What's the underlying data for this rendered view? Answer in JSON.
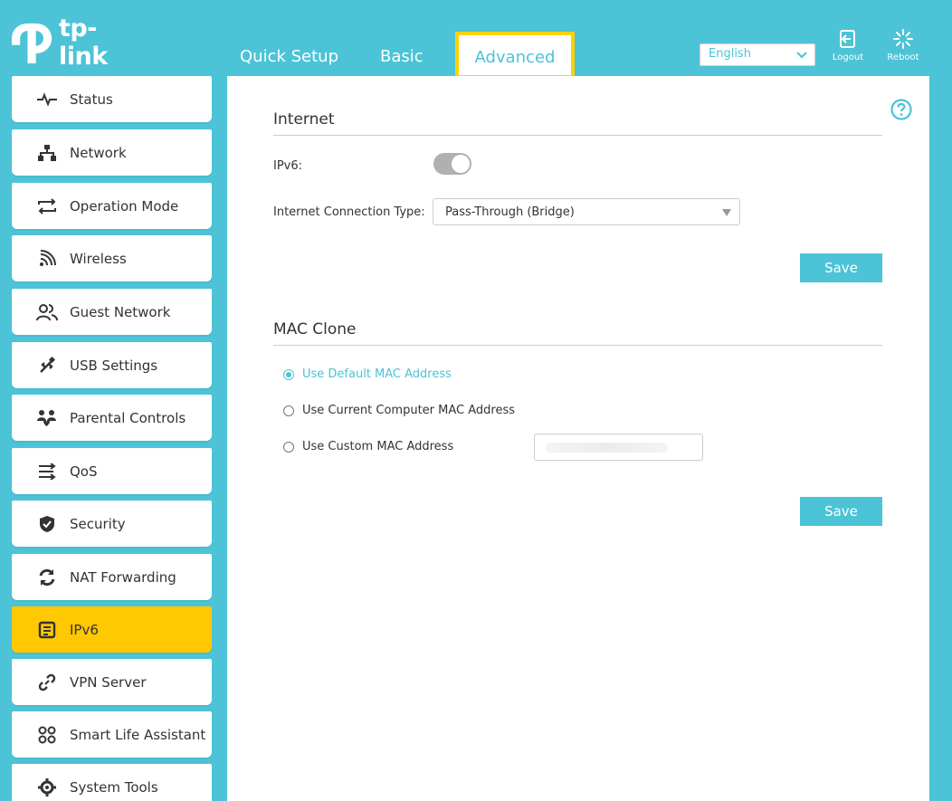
{
  "header": {
    "logo_text": "tp-link",
    "tabs": [
      {
        "label": "Quick Setup"
      },
      {
        "label": "Basic"
      },
      {
        "label": "Advanced"
      }
    ],
    "language": "English",
    "logout_label": "Logout",
    "reboot_label": "Reboot"
  },
  "sidebar": {
    "items": [
      {
        "label": "Status",
        "icon": "pulse-icon"
      },
      {
        "label": "Network",
        "icon": "network-icon"
      },
      {
        "label": "Operation Mode",
        "icon": "swap-arrows-icon"
      },
      {
        "label": "Wireless",
        "icon": "wifi-icon"
      },
      {
        "label": "Guest Network",
        "icon": "guests-icon"
      },
      {
        "label": "USB Settings",
        "icon": "usb-icon"
      },
      {
        "label": "Parental Controls",
        "icon": "family-icon"
      },
      {
        "label": "QoS",
        "icon": "qos-icon"
      },
      {
        "label": "Security",
        "icon": "shield-icon"
      },
      {
        "label": "NAT Forwarding",
        "icon": "refresh-icon"
      },
      {
        "label": "IPv6",
        "icon": "document-icon"
      },
      {
        "label": "VPN Server",
        "icon": "link-icon"
      },
      {
        "label": "Smart Life Assistant",
        "icon": "grid-icon"
      },
      {
        "label": "System Tools",
        "icon": "gear-icon"
      }
    ],
    "active": "IPv6"
  },
  "internet": {
    "title": "Internet",
    "ipv6_label": "IPv6:",
    "ipv6_enabled": true,
    "connection_type_label": "Internet Connection Type:",
    "connection_type_value": "Pass-Through (Bridge)",
    "save_label": "Save"
  },
  "mac_clone": {
    "title": "MAC Clone",
    "options": [
      {
        "label": "Use Default MAC Address",
        "selected": true
      },
      {
        "label": "Use Current Computer MAC Address",
        "selected": false
      },
      {
        "label": "Use Custom MAC Address",
        "selected": false
      }
    ],
    "save_label": "Save"
  },
  "colors": {
    "accent": "#4cc3d6",
    "active_tab_border": "#ffd200",
    "active_sidebar": "#ffc800"
  }
}
